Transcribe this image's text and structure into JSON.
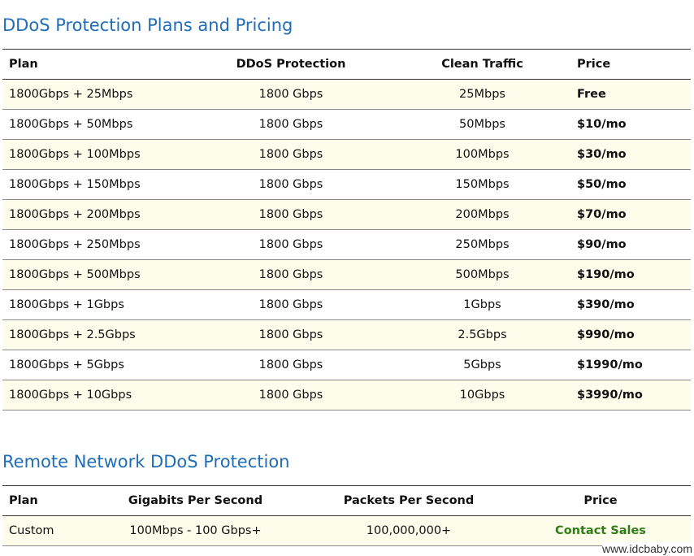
{
  "section1": {
    "title": "DDoS Protection Plans and Pricing",
    "headers": [
      "Plan",
      "DDoS Protection",
      "Clean Traffic",
      "Price"
    ],
    "rows": [
      {
        "plan": "1800Gbps + 25Mbps",
        "protection": "1800 Gbps",
        "traffic": "25Mbps",
        "price": "Free"
      },
      {
        "plan": "1800Gbps + 50Mbps",
        "protection": "1800 Gbps",
        "traffic": "50Mbps",
        "price": "$10/mo"
      },
      {
        "plan": "1800Gbps + 100Mbps",
        "protection": "1800 Gbps",
        "traffic": "100Mbps",
        "price": "$30/mo"
      },
      {
        "plan": "1800Gbps + 150Mbps",
        "protection": "1800 Gbps",
        "traffic": "150Mbps",
        "price": "$50/mo"
      },
      {
        "plan": "1800Gbps + 200Mbps",
        "protection": "1800 Gbps",
        "traffic": "200Mbps",
        "price": "$70/mo"
      },
      {
        "plan": "1800Gbps + 250Mbps",
        "protection": "1800 Gbps",
        "traffic": "250Mbps",
        "price": "$90/mo"
      },
      {
        "plan": "1800Gbps + 500Mbps",
        "protection": "1800 Gbps",
        "traffic": "500Mbps",
        "price": "$190/mo"
      },
      {
        "plan": "1800Gbps + 1Gbps",
        "protection": "1800 Gbps",
        "traffic": "1Gbps",
        "price": "$390/mo"
      },
      {
        "plan": "1800Gbps + 2.5Gbps",
        "protection": "1800 Gbps",
        "traffic": "2.5Gbps",
        "price": "$990/mo"
      },
      {
        "plan": "1800Gbps + 5Gbps",
        "protection": "1800 Gbps",
        "traffic": "5Gbps",
        "price": "$1990/mo"
      },
      {
        "plan": "1800Gbps + 10Gbps",
        "protection": "1800 Gbps",
        "traffic": "10Gbps",
        "price": "$3990/mo"
      }
    ]
  },
  "section2": {
    "title": "Remote Network DDoS Protection",
    "headers": [
      "Plan",
      "Gigabits Per Second",
      "Packets Per Second",
      "Price"
    ],
    "rows": [
      {
        "plan": "Custom",
        "gbps": "100Mbps - 100 Gbps+",
        "pps": "100,000,000+",
        "price": "Contact Sales"
      }
    ]
  },
  "watermark": "www.idcbaby.com",
  "colors": {
    "title": "#1f6db8",
    "row_highlight": "#fefdec",
    "contact_sales": "#2e7d16"
  }
}
